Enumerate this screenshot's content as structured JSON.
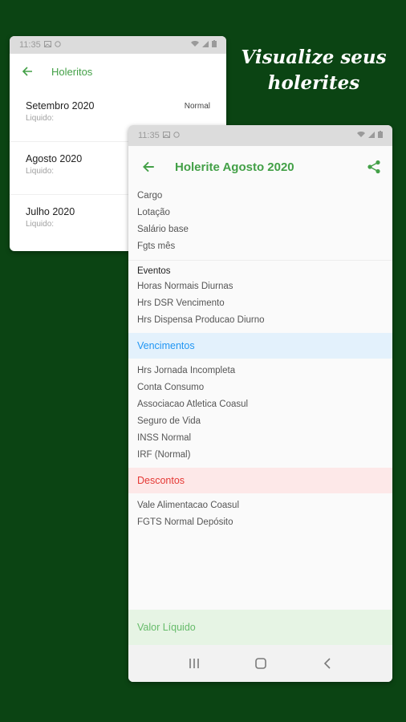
{
  "headline": [
    "Visualize seus",
    "holerites"
  ],
  "colors": {
    "background": "#0b4413",
    "accent": "#43a047",
    "vencimentos": "#2196f3",
    "descontos": "#e53935"
  },
  "back_phone": {
    "status_time": "11:35",
    "title": "Holeritos",
    "items": [
      {
        "month": "Setembro 2020",
        "liquido_label": "Liquido:",
        "tag": "Normal"
      },
      {
        "month": "Agosto 2020",
        "liquido_label": "Liquido:",
        "tag": ""
      },
      {
        "month": "Julho 2020",
        "liquido_label": "Liquido:",
        "tag": ""
      }
    ]
  },
  "front_phone": {
    "status_time": "11:35",
    "title": "Holerite Agosto 2020",
    "info_rows": [
      "Cargo",
      "Lotação",
      "Salário base",
      "Fgts mês"
    ],
    "eventos_heading": "Eventos",
    "eventos": [
      "Horas Normais Diurnas",
      "Hrs DSR Vencimento",
      "Hrs Dispensa Producao Diurno"
    ],
    "vencimentos_label": "Vencimentos",
    "vencimentos": [
      "Hrs Jornada Incompleta",
      "Conta Consumo",
      "Associacao Atletica Coasul",
      "Seguro de Vida",
      "INSS Normal",
      "IRF (Normal)"
    ],
    "descontos_label": "Descontos",
    "descontos": [
      "Vale Alimentacao Coasul",
      "FGTS Normal Depósito"
    ],
    "valor_liquido_label": "Valor Líquido"
  },
  "icons": [
    "back-arrow-icon",
    "share-icon",
    "recents-icon",
    "home-icon",
    "back-nav-icon",
    "wifi-icon",
    "battery-icon"
  ]
}
